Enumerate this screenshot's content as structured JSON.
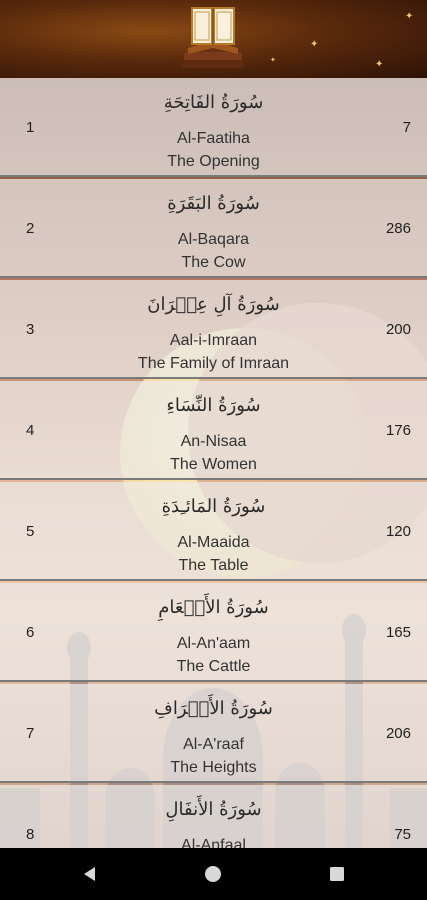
{
  "header": {
    "logo_icon": "quran-book-icon"
  },
  "surahs": [
    {
      "number": "1",
      "arabic": "سُورَةُ الفَاتِحَةِ",
      "transliteration": "Al-Faatiha",
      "english": "The Opening",
      "verses": "7"
    },
    {
      "number": "2",
      "arabic": "سُورَةُ البَقَرَةِ",
      "transliteration": "Al-Baqara",
      "english": "The Cow",
      "verses": "286"
    },
    {
      "number": "3",
      "arabic": "سُورَةُ آلِ عِمۡرَانَ",
      "transliteration": "Aal-i-Imraan",
      "english": "The Family of Imraan",
      "verses": "200"
    },
    {
      "number": "4",
      "arabic": "سُورَةُ النِّسَاءِ",
      "transliteration": "An-Nisaa",
      "english": "The Women",
      "verses": "176"
    },
    {
      "number": "5",
      "arabic": "سُورَةُ المَائـِدَةِ",
      "transliteration": "Al-Maaida",
      "english": "The Table",
      "verses": "120"
    },
    {
      "number": "6",
      "arabic": "سُورَةُ الأَنۡعَامِ",
      "transliteration": "Al-An'aam",
      "english": "The Cattle",
      "verses": "165"
    },
    {
      "number": "7",
      "arabic": "سُورَةُ الأَعۡرَافِ",
      "transliteration": "Al-A'raaf",
      "english": "The Heights",
      "verses": "206"
    },
    {
      "number": "8",
      "arabic": "سُورَةُ الأَنفَالِ",
      "transliteration": "Al-Anfaal",
      "english": "",
      "verses": "75"
    }
  ],
  "navbar": {
    "back_icon": "back-triangle-icon",
    "home_icon": "home-circle-icon",
    "recents_icon": "recents-square-icon"
  }
}
